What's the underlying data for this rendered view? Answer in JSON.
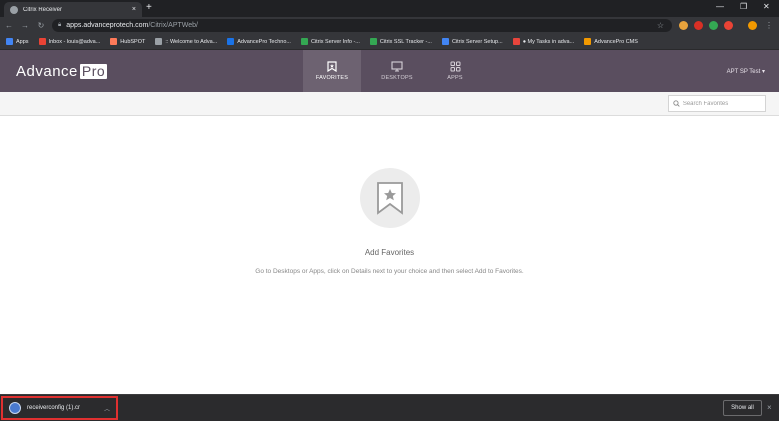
{
  "browser": {
    "tab_title": "Citrix Receiver",
    "tab_close": "×",
    "new_tab": "+",
    "url_host": "apps.advanceprotech.com",
    "url_path": "/Citrix/APTWeb/",
    "bookmarks": [
      {
        "label": "Apps",
        "color": "#4285f4"
      },
      {
        "label": "Inbox - louis@adva...",
        "color": "#ea4335"
      },
      {
        "label": "HubSPOT",
        "color": "#ff7a59"
      },
      {
        "label": ":: Welcome to Adva...",
        "color": "#9aa0a6"
      },
      {
        "label": "AdvancePro Techno...",
        "color": "#1a73e8"
      },
      {
        "label": "Citrix Server Info -...",
        "color": "#34a853"
      },
      {
        "label": "Citrix SSL Tracker -...",
        "color": "#34a853"
      },
      {
        "label": "Citrix Server Setup...",
        "color": "#4285f4"
      },
      {
        "label": "● My Tasks in adva...",
        "color": "#e8453c"
      },
      {
        "label": "AdvancePro CMS",
        "color": "#f29900"
      }
    ]
  },
  "app": {
    "logo_text": "Advance",
    "logo_badge": "Pro",
    "nav": [
      {
        "label": "FAVORITES",
        "active": true
      },
      {
        "label": "DESKTOPS",
        "active": false
      },
      {
        "label": "APPS",
        "active": false
      }
    ],
    "user_label": "APT SP Test ▾",
    "search_placeholder": "Search Favorites",
    "accent_color": "#5a4e5f"
  },
  "empty_state": {
    "title": "Add Favorites",
    "description": "Go to Desktops or Apps, click on Details next to your choice and then select Add to Favorites."
  },
  "download_bar": {
    "file_name": "receiverconfig (1).cr",
    "show_all": "Show all",
    "close": "×"
  }
}
